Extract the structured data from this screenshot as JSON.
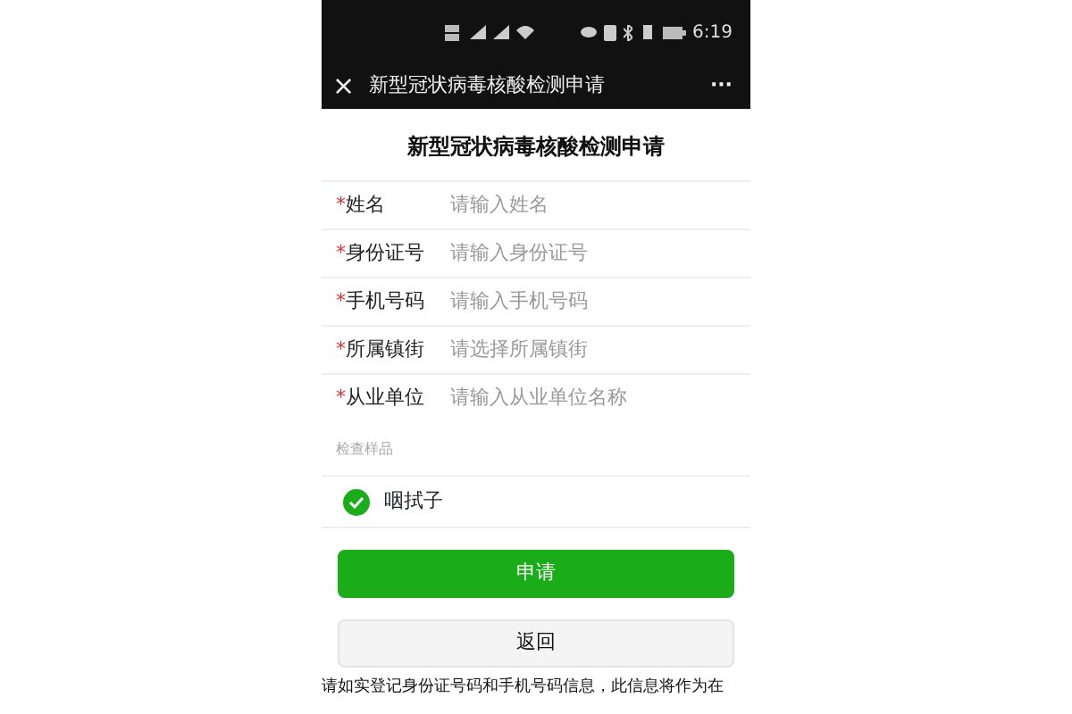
{
  "status_bar": {
    "time": "6:19"
  },
  "nav_bar": {
    "close": "×",
    "title": "新型冠状病毒核酸检测申请",
    "more": "···"
  },
  "form": {
    "title": "新型冠状病毒核酸检测申请",
    "fields": [
      {
        "label": "姓名",
        "required_mark": "*",
        "placeholder": "请输入姓名"
      },
      {
        "label": "身份证号",
        "required_mark": "*",
        "placeholder": "请输入身份证号"
      },
      {
        "label": "手机号码",
        "required_mark": "*",
        "placeholder": "请输入手机号码"
      },
      {
        "label": "所属镇街",
        "required_mark": "*",
        "placeholder": "请选择所属镇街"
      },
      {
        "label": "从业单位",
        "required_mark": "*",
        "placeholder": "请输入从业单位名称"
      }
    ],
    "section_label": "检查样品",
    "options": [
      {
        "label": "咽拭子",
        "selected": true
      }
    ],
    "buttons": [
      {
        "label": "申请",
        "kind": "primary"
      },
      {
        "label": "返回",
        "kind": "secondary"
      }
    ],
    "notice": "请如实登记身份证号码和手机号码信息，此信息将作为在"
  }
}
